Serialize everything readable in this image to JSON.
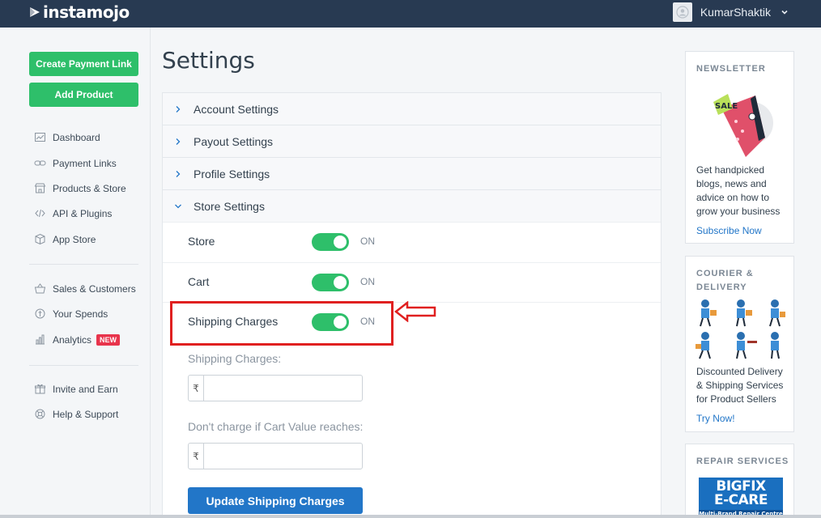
{
  "header": {
    "logo_text": "instamojo",
    "username": "KumarShaktik"
  },
  "sidebar": {
    "create_payment_link": "Create Payment Link",
    "add_product": "Add Product",
    "nav_main": [
      {
        "label": "Dashboard",
        "icon": "dashboard-icon"
      },
      {
        "label": "Payment Links",
        "icon": "link-icon"
      },
      {
        "label": "Products & Store",
        "icon": "store-icon"
      },
      {
        "label": "API & Plugins",
        "icon": "code-icon"
      },
      {
        "label": "App Store",
        "icon": "box-icon"
      }
    ],
    "nav_secondary": [
      {
        "label": "Sales & Customers",
        "icon": "basket-icon"
      },
      {
        "label": "Your Spends",
        "icon": "wallet-icon"
      },
      {
        "label": "Analytics",
        "icon": "chart-icon",
        "badge": "NEW"
      }
    ],
    "nav_footer": [
      {
        "label": "Invite and Earn",
        "icon": "gift-icon"
      },
      {
        "label": "Help & Support",
        "icon": "lifebuoy-icon"
      }
    ]
  },
  "main": {
    "title": "Settings",
    "sections": [
      {
        "label": "Account Settings",
        "expanded": false
      },
      {
        "label": "Payout Settings",
        "expanded": false
      },
      {
        "label": "Profile Settings",
        "expanded": false
      },
      {
        "label": "Store Settings",
        "expanded": true
      }
    ],
    "store_settings": {
      "toggles": [
        {
          "label": "Store",
          "state": "ON"
        },
        {
          "label": "Cart",
          "state": "ON"
        },
        {
          "label": "Shipping Charges",
          "state": "ON"
        }
      ],
      "shipping_charges_label": "Shipping Charges:",
      "cart_value_label": "Don't charge if Cart Value reaches:",
      "currency_symbol": "₹",
      "shipping_charges_value": "",
      "cart_value_value": "",
      "update_button": "Update Shipping Charges"
    }
  },
  "rightbar": {
    "newsletter": {
      "title": "NEWSLETTER",
      "text": [
        "Get handpicked",
        "blogs, news and",
        "advice on how to",
        "grow your business"
      ],
      "link": "Subscribe Now"
    },
    "courier": {
      "title": [
        "COURIER &",
        "DELIVERY"
      ],
      "text": [
        "Discounted Delivery",
        "& Shipping Services",
        "for Product Sellers"
      ],
      "link": "Try Now!"
    },
    "repair": {
      "title": "REPAIR SERVICES",
      "logo_line1": "BIGFIX",
      "logo_line2": "E-CARE",
      "logo_line3": "Multi-Brand Repair Centre"
    }
  },
  "colors": {
    "topbar": "#283a52",
    "green": "#2ebf6a",
    "blue": "#2276c8",
    "annotation_red": "#e02020"
  }
}
